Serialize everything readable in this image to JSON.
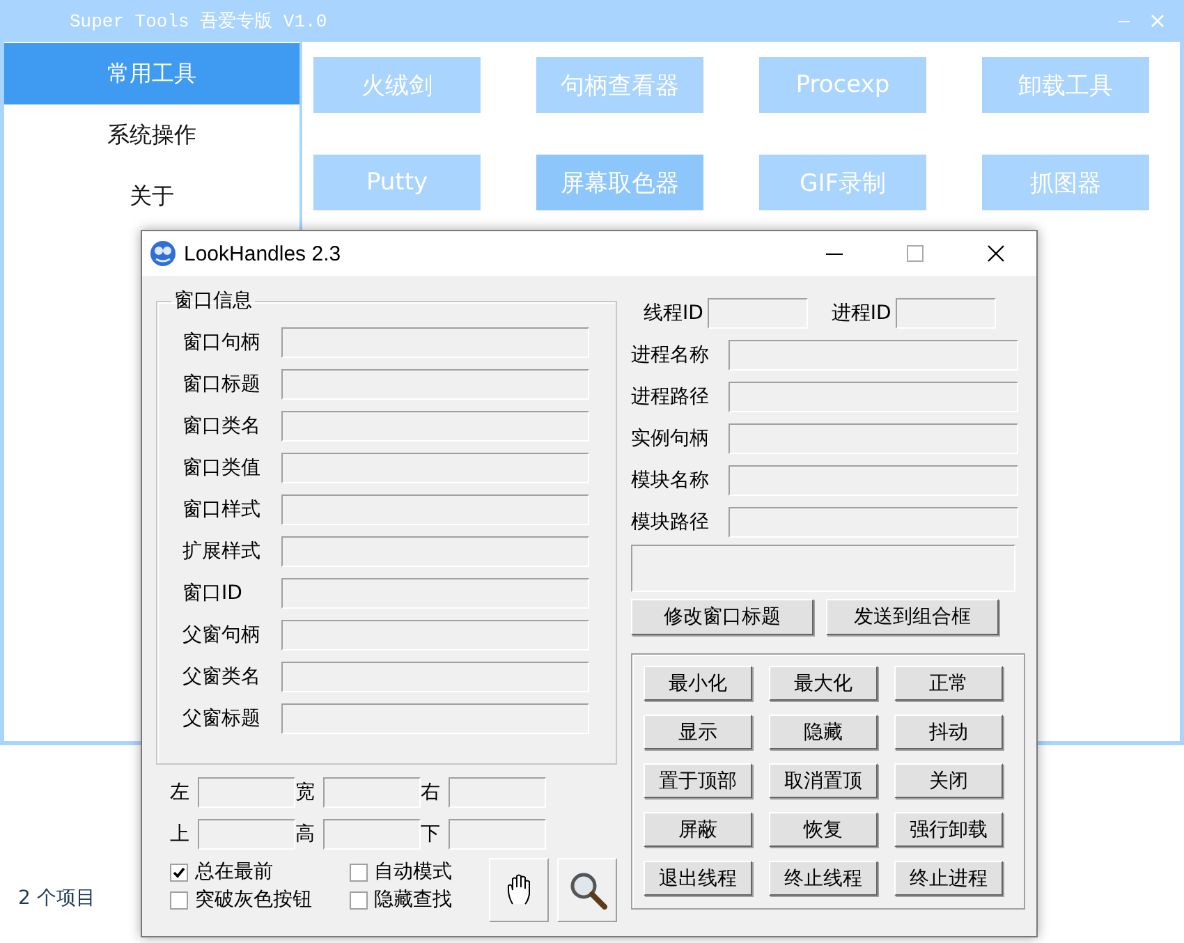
{
  "main_window": {
    "title": "Super Tools 吾爱专版 V1.0",
    "sidebar": [
      {
        "label": "常用工具",
        "selected": true
      },
      {
        "label": "系统操作",
        "selected": false
      },
      {
        "label": "关于",
        "selected": false
      }
    ],
    "tools": [
      {
        "label": "火绒剑",
        "hovered": false
      },
      {
        "label": "句柄查看器",
        "hovered": false
      },
      {
        "label": "Procexp",
        "hovered": false
      },
      {
        "label": "卸载工具",
        "hovered": false
      },
      {
        "label": "Putty",
        "hovered": false
      },
      {
        "label": "屏幕取色器",
        "hovered": true
      },
      {
        "label": "GIF录制",
        "hovered": false
      },
      {
        "label": "抓图器",
        "hovered": false
      }
    ]
  },
  "status_bar": {
    "item_count": "2 个项目"
  },
  "dialog": {
    "title": "LookHandles 2.3",
    "window_info": {
      "title": "窗口信息",
      "fields": [
        "窗口句柄",
        "窗口标题",
        "窗口类名",
        "窗口类值",
        "窗口样式",
        "扩展样式",
        "窗口ID",
        "父窗句柄",
        "父窗类名",
        "父窗标题"
      ]
    },
    "thread_id_label": "线程ID",
    "process_id_label": "进程ID",
    "process_fields": [
      "进程名称",
      "进程路径",
      "实例句柄",
      "模块名称",
      "模块路径"
    ],
    "buttons": [
      "修改窗口标题",
      "发送到组合框"
    ],
    "actions": [
      "最小化",
      "最大化",
      "正常",
      "显示",
      "隐藏",
      "抖动",
      "置于顶部",
      "取消置顶",
      "关闭",
      "屏蔽",
      "恢复",
      "强行卸载",
      "退出线程",
      "终止线程",
      "终止进程"
    ],
    "geometry": [
      "左",
      "宽",
      "右",
      "上",
      "高",
      "下"
    ],
    "options": [
      {
        "label": "总在最前",
        "checked": true
      },
      {
        "label": "自动模式",
        "checked": false
      },
      {
        "label": "突破灰色按钮",
        "checked": false
      },
      {
        "label": "隐藏查找",
        "checked": false
      }
    ]
  }
}
